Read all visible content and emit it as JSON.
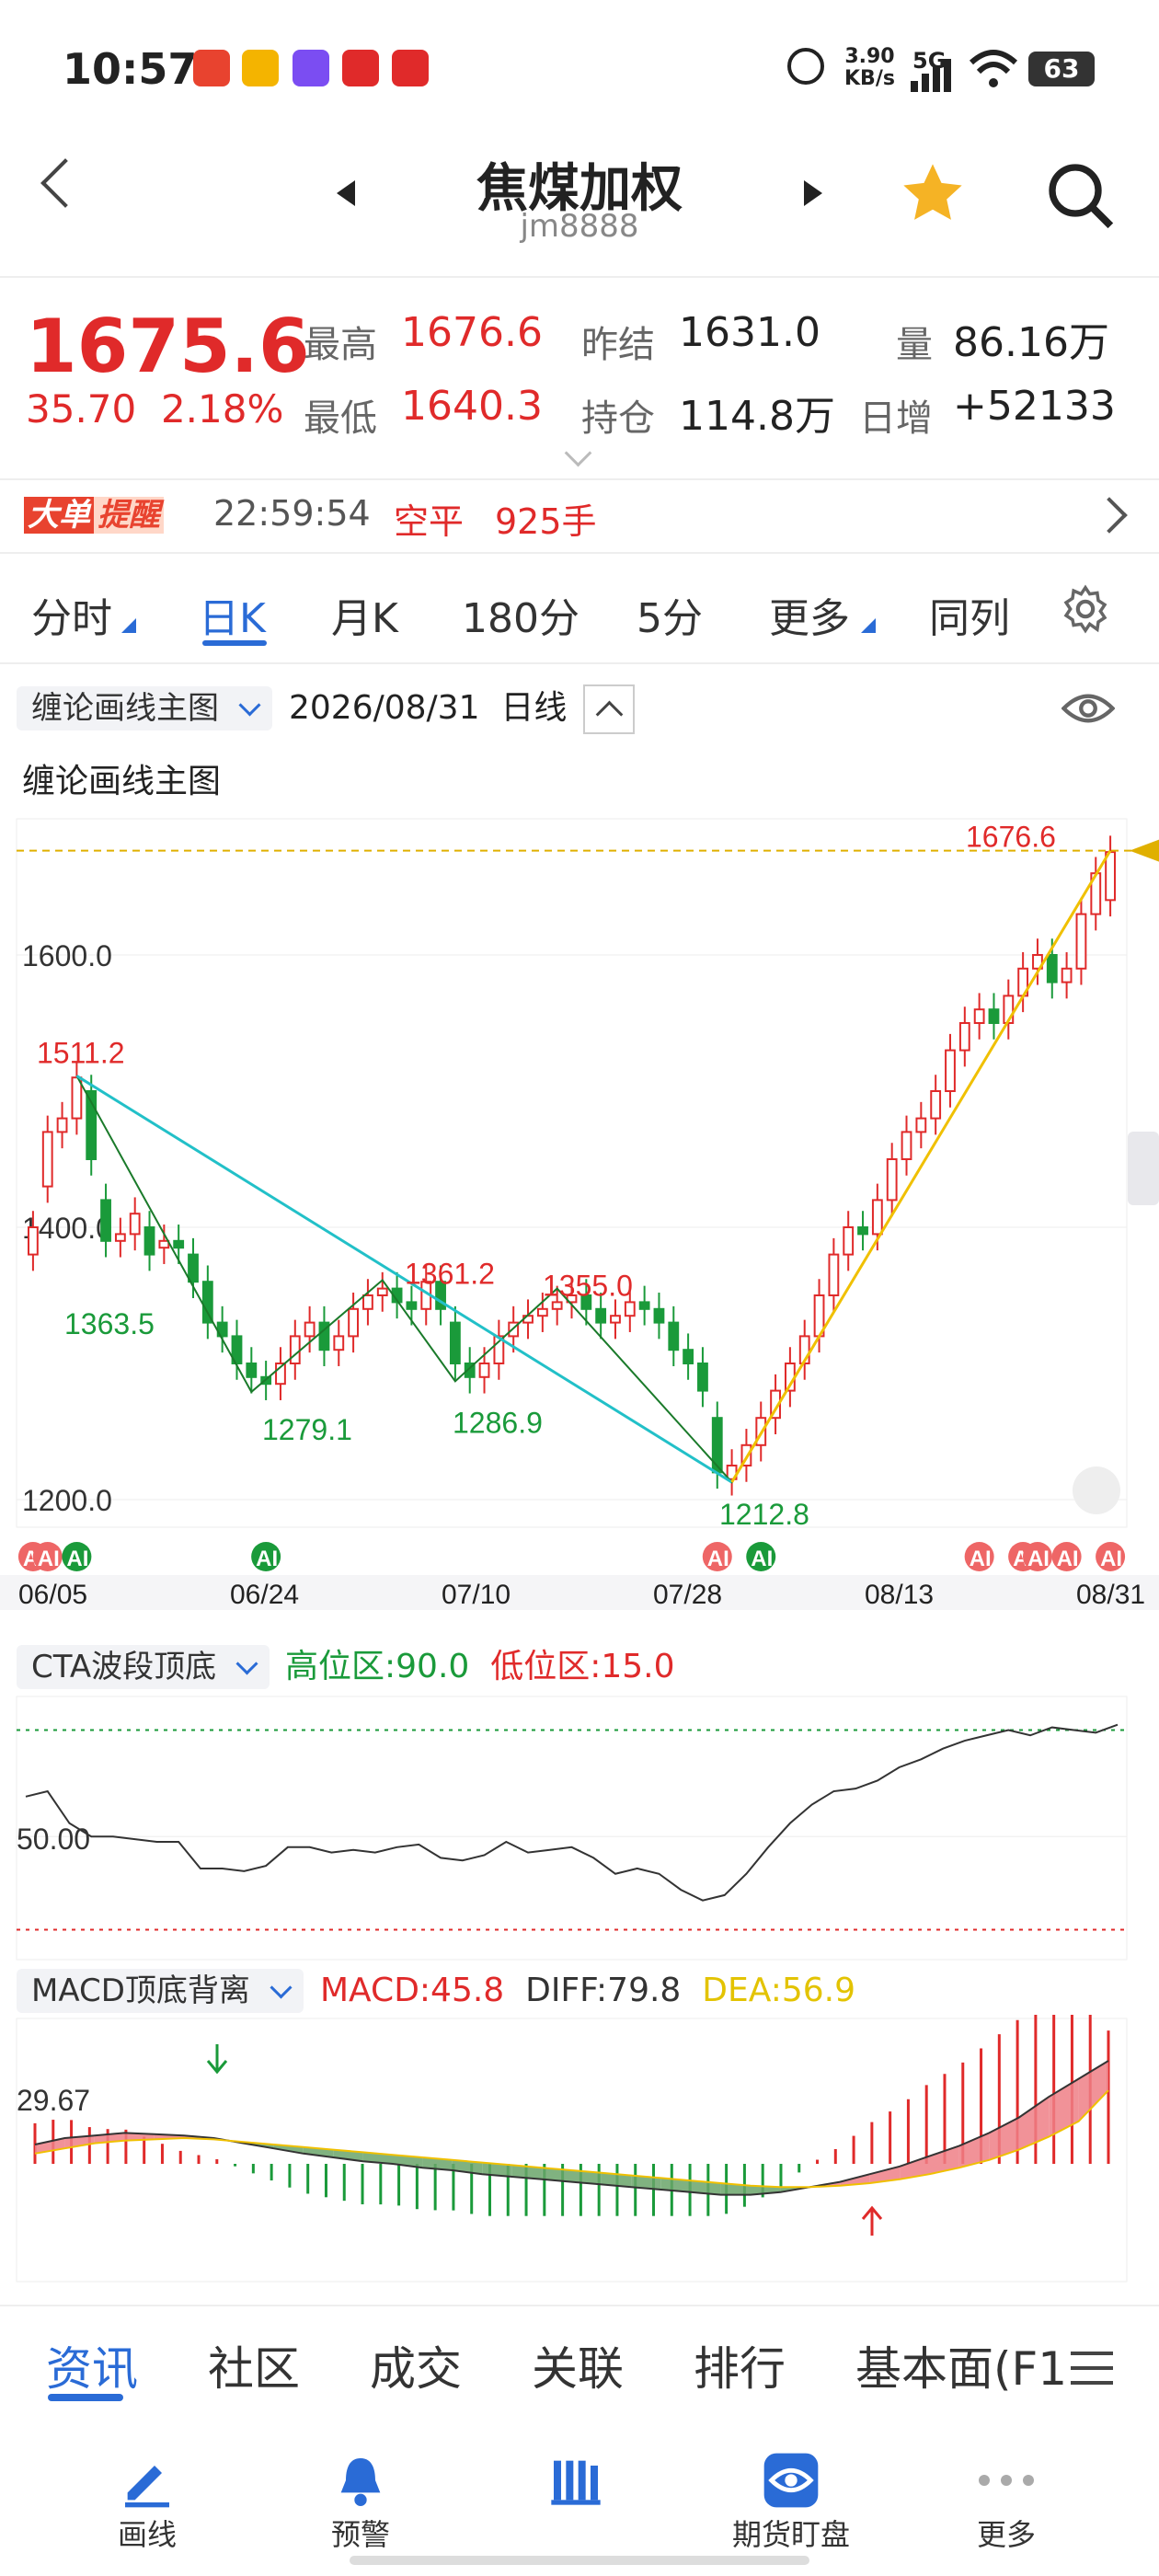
{
  "status": {
    "time": "10:57",
    "net_speed": "3.90",
    "net_unit": "KB/s",
    "signal": "5G",
    "battery": "63"
  },
  "header": {
    "title": "焦煤加权",
    "subtitle": "jm8888"
  },
  "quote": {
    "price": "1675.6",
    "change": "35.70",
    "change_pct": "2.18%",
    "high_label": "最高",
    "high": "1676.6",
    "low_label": "最低",
    "low": "1640.3",
    "prev_settle_label": "昨结",
    "prev_settle": "1631.0",
    "oi_label": "持仓",
    "oi": "114.8万",
    "vol_label": "量",
    "vol": "86.16万",
    "daily_inc_label": "日增",
    "daily_inc": "+52133"
  },
  "alert": {
    "tag1": "大单",
    "tag2": "提醒",
    "time": "22:59:54",
    "type": "空平",
    "qty": "925手"
  },
  "tabs": [
    "分时",
    "日K",
    "月K",
    "180分",
    "5分",
    "更多",
    "同列"
  ],
  "main_panel": {
    "selector": "缠论画线主图",
    "date": "2026/08/31",
    "period": "日线",
    "title": "缠论画线主图"
  },
  "cta_panel": {
    "selector": "CTA波段顶底",
    "high_zone": "高位区:90.0",
    "low_zone": "低位区:15.0",
    "axis": "50.00"
  },
  "macd_panel": {
    "selector": "MACD顶底背离",
    "macd": "MACD:45.8",
    "diff": "DIFF:79.8",
    "dea": "DEA:56.9",
    "axis": "29.67"
  },
  "chart_data": {
    "type": "candlestick",
    "y_ticks": [
      "1600.0",
      "1400.0",
      "1200.0"
    ],
    "x_ticks": [
      "06/05",
      "06/24",
      "07/10",
      "07/28",
      "08/13",
      "08/31"
    ],
    "ylim": [
      1200,
      1700
    ],
    "annotations": [
      {
        "label": "1676.6",
        "value": 1676.6,
        "color": "#e02a2a"
      },
      {
        "label": "1511.2",
        "value": 1511.2,
        "color": "#e02a2a"
      },
      {
        "label": "1363.5",
        "value": 1363.5,
        "color": "#1a9a3a"
      },
      {
        "label": "1361.2",
        "value": 1361.2,
        "color": "#e02a2a"
      },
      {
        "label": "1355.0",
        "value": 1355.0,
        "color": "#e02a2a"
      },
      {
        "label": "1279.1",
        "value": 1279.1,
        "color": "#1a9a3a"
      },
      {
        "label": "1286.9",
        "value": 1286.9,
        "color": "#1a9a3a"
      },
      {
        "label": "1212.8",
        "value": 1212.8,
        "color": "#1a9a3a"
      }
    ],
    "closes": [
      1400,
      1470,
      1480,
      1510,
      1450,
      1390,
      1395,
      1410,
      1380,
      1390,
      1385,
      1360,
      1330,
      1320,
      1300,
      1290,
      1285,
      1300,
      1320,
      1330,
      1310,
      1320,
      1340,
      1350,
      1355,
      1345,
      1340,
      1360,
      1340,
      1300,
      1290,
      1300,
      1320,
      1330,
      1335,
      1340,
      1345,
      1350,
      1340,
      1330,
      1335,
      1345,
      1340,
      1330,
      1310,
      1300,
      1280,
      1220,
      1225,
      1240,
      1260,
      1280,
      1300,
      1320,
      1350,
      1380,
      1400,
      1395,
      1420,
      1450,
      1470,
      1480,
      1500,
      1530,
      1550,
      1560,
      1550,
      1570,
      1590,
      1600,
      1580,
      1590,
      1630,
      1660,
      1675.6
    ],
    "opens": [
      1380,
      1430,
      1470,
      1480,
      1500,
      1420,
      1390,
      1395,
      1400,
      1385,
      1390,
      1380,
      1360,
      1330,
      1320,
      1300,
      1290,
      1285,
      1300,
      1320,
      1330,
      1310,
      1320,
      1340,
      1350,
      1355,
      1345,
      1340,
      1360,
      1330,
      1300,
      1290,
      1300,
      1320,
      1330,
      1335,
      1340,
      1345,
      1350,
      1340,
      1330,
      1335,
      1345,
      1340,
      1330,
      1310,
      1300,
      1260,
      1215,
      1225,
      1240,
      1260,
      1280,
      1300,
      1320,
      1350,
      1380,
      1400,
      1395,
      1420,
      1450,
      1470,
      1480,
      1500,
      1530,
      1550,
      1560,
      1550,
      1570,
      1590,
      1600,
      1580,
      1590,
      1630,
      1640.3
    ],
    "cta_values": [
      65,
      67,
      55,
      50,
      50,
      49,
      48,
      48,
      38,
      38,
      37,
      39,
      46,
      46,
      44,
      45,
      44,
      46,
      47,
      42,
      41,
      43,
      48,
      44,
      45,
      46,
      42,
      36,
      38,
      36,
      30,
      26,
      28,
      36,
      46,
      55,
      62,
      67,
      68,
      71,
      76,
      79,
      83,
      86,
      88,
      90,
      88,
      91,
      90,
      89,
      92
    ],
    "macd_diff": [
      15,
      20,
      22,
      24,
      23,
      22,
      20,
      16,
      12,
      8,
      5,
      2,
      0,
      -3,
      -5,
      -8,
      -10,
      -12,
      -14,
      -16,
      -18,
      -20,
      -22,
      -24,
      -24,
      -22,
      -18,
      -14,
      -8,
      -2,
      6,
      14,
      24,
      36,
      52,
      66,
      80
    ],
    "macd_dea": [
      8,
      12,
      16,
      18,
      19,
      20,
      19,
      17,
      15,
      13,
      11,
      9,
      7,
      5,
      3,
      1,
      -1,
      -3,
      -5,
      -7,
      -9,
      -11,
      -13,
      -15,
      -17,
      -18,
      -18,
      -17,
      -15,
      -12,
      -8,
      -3,
      3,
      11,
      21,
      33,
      57
    ]
  }
}
